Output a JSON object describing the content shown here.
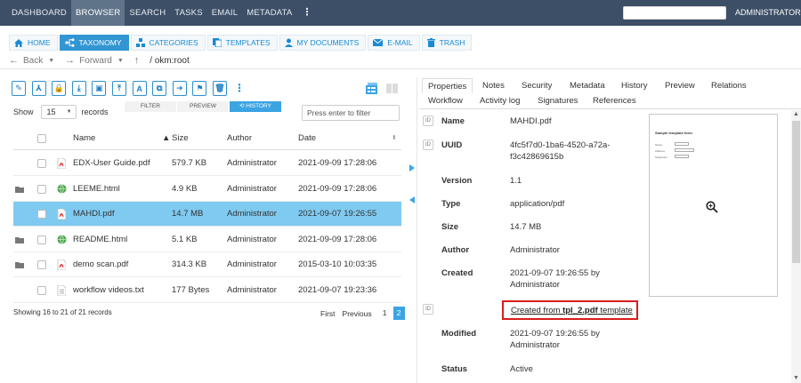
{
  "topnav": {
    "items": [
      "DASHBOARD",
      "BROWSER",
      "SEARCH",
      "TASKS",
      "EMAIL",
      "METADATA"
    ],
    "active": "BROWSER",
    "more": "⋮",
    "user": "ADMINISTRATOR ▾"
  },
  "perspective_tabs": [
    {
      "label": "HOME",
      "icon": "home-icon"
    },
    {
      "label": "TAXONOMY",
      "icon": "taxonomy-icon",
      "active": true
    },
    {
      "label": "CATEGORIES",
      "icon": "categories-icon"
    },
    {
      "label": "TEMPLATES",
      "icon": "templates-icon"
    },
    {
      "label": "MY DOCUMENTS",
      "icon": "user-icon"
    },
    {
      "label": "E-MAIL",
      "icon": "mail-icon"
    },
    {
      "label": "TRASH",
      "icon": "trash-icon"
    }
  ],
  "navigation": {
    "back": "Back",
    "forward": "Forward",
    "path": "/  okm:root"
  },
  "toolbar": {
    "icons": [
      "edit-icon",
      "split-icon",
      "lock-icon",
      "download-icon",
      "image-icon",
      "upload-icon",
      "text-icon",
      "copy-icon",
      "move-icon",
      "bookmark-icon",
      "delete-icon"
    ],
    "more": "⋮"
  },
  "list_controls": {
    "show_label": "Show",
    "page_size": "15",
    "records_label": "records",
    "subtabs": [
      "FILTER",
      "PREVIEW",
      "HISTORY"
    ],
    "active_subtab": "HISTORY",
    "filter_placeholder": "Press enter to filter"
  },
  "table": {
    "columns": [
      "Name",
      "Size",
      "Author",
      "Date"
    ],
    "rows": [
      {
        "name": "EDX-User Guide.pdf",
        "size": "579.7 KB",
        "author": "Administrator",
        "date": "2021-09-09 17:28:06",
        "type": "pdf",
        "folder": false,
        "selected": false
      },
      {
        "name": "LEEME.html",
        "size": "4.9 KB",
        "author": "Administrator",
        "date": "2021-09-09 17:28:06",
        "type": "html",
        "folder": true,
        "selected": false
      },
      {
        "name": "MAHDI.pdf",
        "size": "14.7 MB",
        "author": "Administrator",
        "date": "2021-09-07 19:26:55",
        "type": "pdf",
        "folder": false,
        "selected": true
      },
      {
        "name": "README.html",
        "size": "5.1 KB",
        "author": "Administrator",
        "date": "2021-09-09 17:28:06",
        "type": "html",
        "folder": true,
        "selected": false
      },
      {
        "name": "demo scan.pdf",
        "size": "314.3 KB",
        "author": "Administrator",
        "date": "2015-03-10 10:03:35",
        "type": "pdf",
        "folder": true,
        "selected": false
      },
      {
        "name": "workflow videos.txt",
        "size": "177 Bytes",
        "author": "Administrator",
        "date": "2021-09-07 19:23:36",
        "type": "txt",
        "folder": false,
        "selected": false
      }
    ],
    "footer": "Showing 16 to 21 of 21 records",
    "pager": {
      "first": "First",
      "previous": "Previous",
      "pages": [
        "1",
        "2"
      ],
      "current": "2"
    }
  },
  "detail_tabs": {
    "row1": [
      "Properties",
      "Notes",
      "Security",
      "Metadata",
      "History",
      "Preview",
      "Relations"
    ],
    "row2": [
      "Workflow",
      "Activity log",
      "Signatures",
      "References"
    ],
    "active": "Properties"
  },
  "properties": {
    "name_label": "Name",
    "name": "MAHDI.pdf",
    "uuid_label": "UUID",
    "uuid_line1": "4fc5f7d0-1ba6-4520-a72a-",
    "uuid_line2": "f3c42869615b",
    "version_label": "Version",
    "version": "1.1",
    "type_label": "Type",
    "type": "application/pdf",
    "size_label": "Size",
    "size": "14.7 MB",
    "author_label": "Author",
    "author": "Administrator",
    "created_label": "Created",
    "created_line1": "2021-09-07 19:26:55 by",
    "created_line2": "Administrator",
    "template_prefix": "Created from ",
    "template_name": "tpl_2.pdf",
    "template_suffix": " template",
    "modified_label": "Modified",
    "modified_line1": "2021-09-07 19:26:55 by",
    "modified_line2": "Administrator",
    "status_label": "Status",
    "status": "Active",
    "btn_glyph": "ID"
  },
  "preview_thumb": {
    "title": "Sample template form",
    "fields": [
      "Name",
      "Address",
      "Telephone"
    ],
    "values": [
      "Doe",
      "Fun Mail 123 AB",
      "5550"
    ]
  },
  "colors": {
    "topbar": "#3c4f66",
    "accent": "#3296d3",
    "selected_row": "#7fcaf0",
    "highlight_border": "#d91c1c"
  }
}
